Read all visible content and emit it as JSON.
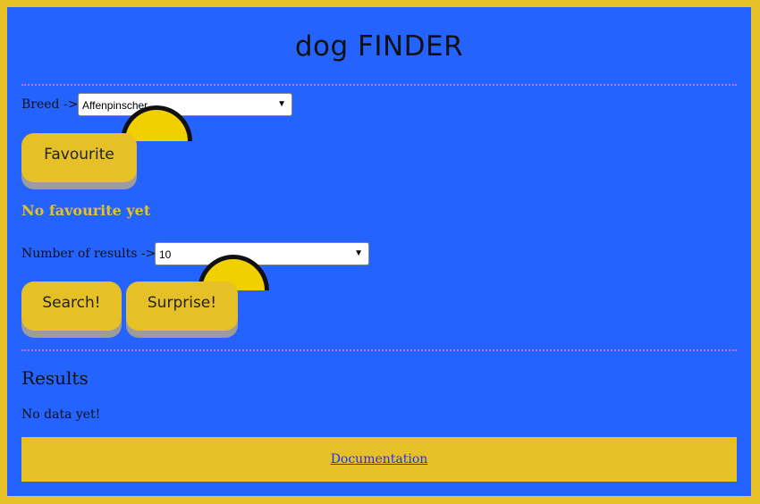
{
  "header": {
    "title": "dog FINDER"
  },
  "breed": {
    "label": "Breed ->",
    "selected": "Affenpinscher"
  },
  "favourite": {
    "button_label": "Favourite",
    "status": "No favourite yet"
  },
  "results_count": {
    "label": "Number of results ->",
    "selected": "10"
  },
  "actions": {
    "search_label": "Search!",
    "surprise_label": "Surprise!"
  },
  "results": {
    "title": "Results",
    "empty_text": "No data yet!"
  },
  "footer": {
    "link_text": "Documentation"
  },
  "colors": {
    "background": "#2563ff",
    "accent": "#e5c027",
    "divider": "#c86bff"
  },
  "icons": {
    "select_arrow": "dropdown-arrow-icon",
    "spinner": "loading-spinner-icon"
  }
}
